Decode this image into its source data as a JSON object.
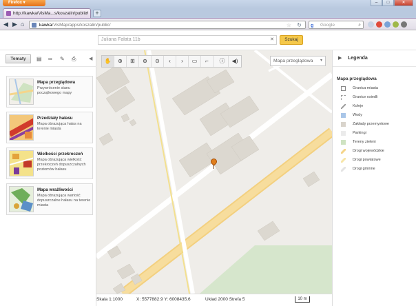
{
  "browser": {
    "app_button": "Firefox",
    "tab_title": "http://kawka/VisMa...s/koszalin/public/",
    "url_domain": "kawka",
    "url_path": "/VisMap/apps/koszalin/public/",
    "search_engine_placeholder": "Google"
  },
  "header": {
    "address_value": "Juliana Fałata 11b",
    "search_button": "Szukaj"
  },
  "left_panel": {
    "tab_label": "Tematy",
    "cards": [
      {
        "title": "Mapa przeglądowa",
        "desc": "Przywrócenie stanu początkowego mapy"
      },
      {
        "title": "Przedziały hałasu",
        "desc": "Mapa obrazująca hałas na terenie miasta"
      },
      {
        "title": "Wielkości przekroczeń",
        "desc": "Mapa obrazująca wielkość przekroczeń dopuszczalnych poziomów hałasu"
      },
      {
        "title": "Mapa wrażliwości",
        "desc": "Mapa obrazująca wartość dopuszczalne hałasu na terenie miasta"
      }
    ]
  },
  "map": {
    "layer_select": "Mapa przeglądowa",
    "toolbar_icons": [
      "hand-icon",
      "zoom-box-icon",
      "zoom-extent-icon",
      "zoom-in-icon",
      "zoom-out-icon",
      "back-icon",
      "forward-icon",
      "measure-line-icon",
      "measure-area-icon",
      "info-icon",
      "sound-icon"
    ]
  },
  "status": {
    "scale": "Skala 1:1000",
    "coords": "X: 5577882.9  Y: 6008435.6",
    "crs": "Układ 2000 Strefa 5",
    "scalebar": "10 m"
  },
  "legend": {
    "title": "Legenda",
    "subtitle": "Mapa przeglądowa",
    "items": [
      {
        "label": "Granica miasta",
        "color": "#888888"
      },
      {
        "label": "Granice osiedli",
        "color": "#999999"
      },
      {
        "label": "Koleje",
        "color": "#9a9a9a"
      },
      {
        "label": "Wody",
        "color": "#a9c6e8"
      },
      {
        "label": "Zakłady przemysłowe",
        "color": "#d9d4cc"
      },
      {
        "label": "Parkingi",
        "color": "#ebebeb"
      },
      {
        "label": "Tereny zieleni",
        "color": "#cfe3c2"
      },
      {
        "label": "Drogi wojewódzkie",
        "color": "#f5d58a"
      },
      {
        "label": "Drogi powiatowe",
        "color": "#f7e6a9"
      },
      {
        "label": "Drogi gminne",
        "color": "#f2f2f2"
      }
    ]
  }
}
